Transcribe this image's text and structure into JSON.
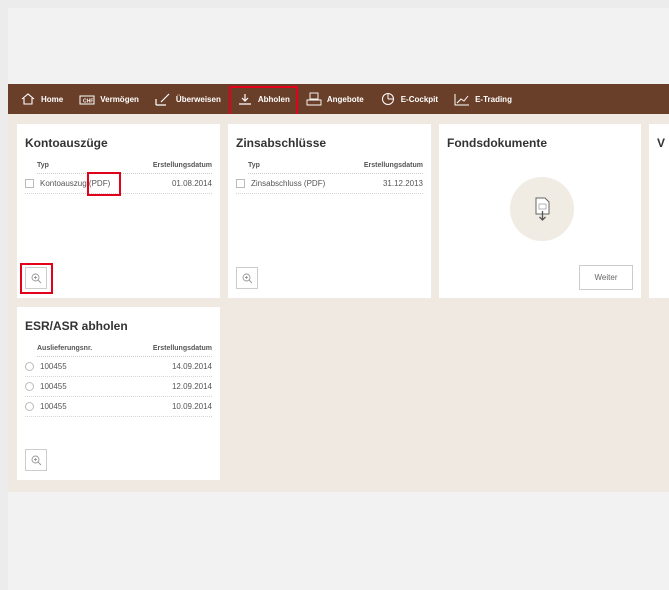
{
  "nav": {
    "items": [
      {
        "label": "Home",
        "icon": "home-icon"
      },
      {
        "label": "Vermögen",
        "icon": "wallet-icon"
      },
      {
        "label": "Überweisen",
        "icon": "edit-icon"
      },
      {
        "label": "Abholen",
        "icon": "download-icon"
      },
      {
        "label": "Angebote",
        "icon": "pdf-tray-icon"
      },
      {
        "label": "E-Cockpit",
        "icon": "pie-chart-icon"
      },
      {
        "label": "E-Trading",
        "icon": "line-chart-icon"
      }
    ]
  },
  "kontoauszuege": {
    "title": "Kontoauszüge",
    "col_type": "Typ",
    "col_date": "Erstellungsdatum",
    "rows": [
      {
        "label": "Kontoauszug (PDF)",
        "date": "01.08.2014"
      }
    ]
  },
  "zinsabschluesse": {
    "title": "Zinsabschlüsse",
    "col_type": "Typ",
    "col_date": "Erstellungsdatum",
    "rows": [
      {
        "label": "Zinsabschluss (PDF)",
        "date": "31.12.2013"
      }
    ]
  },
  "fonds": {
    "title": "Fondsdokumente",
    "button": "Weiter"
  },
  "fourth_card": {
    "title_partial": "V"
  },
  "esr": {
    "title": "ESR/ASR abholen",
    "col_nr": "Auslieferungsnr.",
    "col_date": "Erstellungsdatum",
    "rows": [
      {
        "nr": "100455",
        "date": "14.09.2014"
      },
      {
        "nr": "100455",
        "date": "12.09.2014"
      },
      {
        "nr": "100455",
        "date": "10.09.2014"
      }
    ]
  },
  "colors": {
    "nav_bg": "#6a3f29",
    "highlight": "#e2001a",
    "content_bg": "#efe9e1"
  }
}
